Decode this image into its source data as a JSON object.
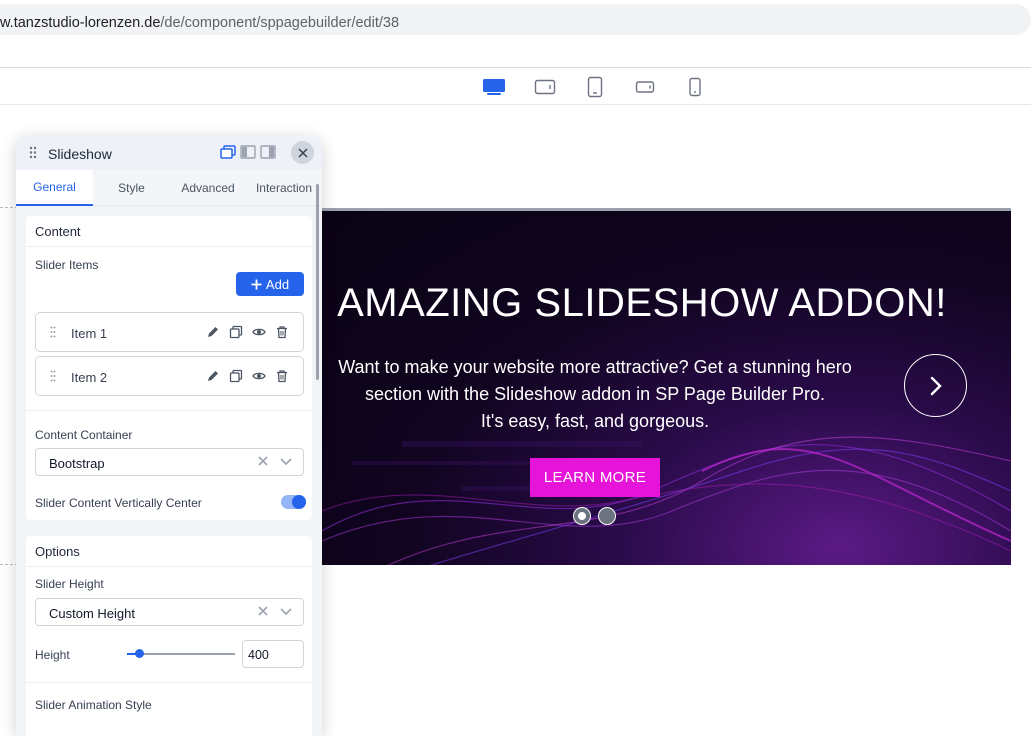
{
  "browser": {
    "url_domain": "w.tanzstudio-lorenzen.de",
    "url_path": "/de/component/sppagebuilder/edit/38"
  },
  "device_toolbar": {
    "items": [
      {
        "name": "desktop",
        "icon": "desktop-icon",
        "active": true
      },
      {
        "name": "tablet-landscape",
        "icon": "tablet-landscape-icon",
        "active": false
      },
      {
        "name": "tablet",
        "icon": "tablet-icon",
        "active": false
      },
      {
        "name": "mobile-landscape",
        "icon": "mobile-landscape-icon",
        "active": false
      },
      {
        "name": "mobile",
        "icon": "mobile-icon",
        "active": false
      }
    ],
    "active_color": "#2563eb"
  },
  "slideshow": {
    "title": "AMAZING SLIDESHOW ADDON!",
    "text_line1": "Want to make your website more attractive? Get a stunning hero",
    "text_line2": "section with the Slideshow addon in SP Page Builder Pro.",
    "text_line3": "It's easy, fast, and gorgeous.",
    "button_label": "LEARN MORE",
    "button_color": "#e614d8",
    "dots": 2,
    "active_dot": 1
  },
  "panel": {
    "title": "Slideshow",
    "tabs": [
      {
        "label": "General",
        "active": true
      },
      {
        "label": "Style",
        "active": false
      },
      {
        "label": "Advanced",
        "active": false
      },
      {
        "label": "Interaction",
        "active": false
      }
    ],
    "content": {
      "heading": "Content",
      "slider_items_label": "Slider Items",
      "add_label": "Add",
      "items": [
        {
          "label": "Item 1"
        },
        {
          "label": "Item 2"
        }
      ],
      "content_container_label": "Content Container",
      "content_container_value": "Bootstrap",
      "vertical_center_label": "Slider Content Vertically Center",
      "vertical_center_on": true
    },
    "options": {
      "heading": "Options",
      "slider_height_label": "Slider Height",
      "slider_height_value": "Custom Height",
      "height_label": "Height",
      "height_value": "400",
      "height_slider_fraction": 0.12,
      "animation_style_label": "Slider Animation Style"
    }
  }
}
